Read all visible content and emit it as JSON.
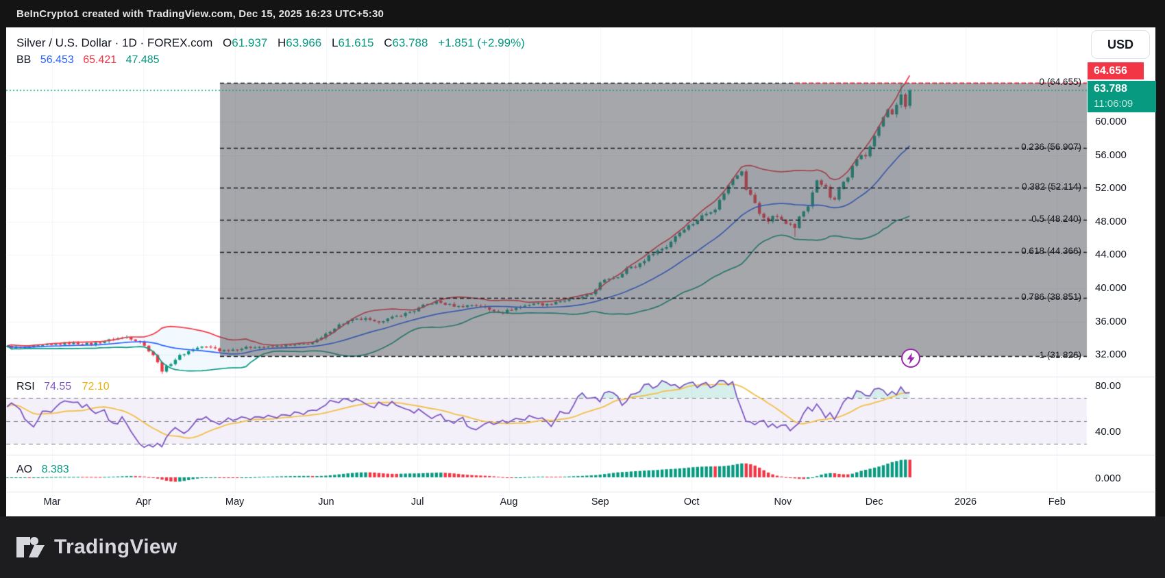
{
  "top_bar": {
    "text": "BeInCrypto1 created with TradingView.com, Dec 15, 2025 16:23 UTC+5:30"
  },
  "legend": {
    "symbol": "Silver / U.S. Dollar",
    "separator": "·",
    "interval": "1D",
    "exchange": "FOREX.com",
    "o_label": "O",
    "o_value": "61.937",
    "h_label": "H",
    "h_value": "63.966",
    "l_label": "L",
    "l_value": "61.615",
    "c_label": "C",
    "c_value": "63.788",
    "change": "+1.851 (+2.99%)",
    "bb_label": "BB",
    "bb_basis": "56.453",
    "bb_upper": "65.421",
    "bb_lower": "47.485",
    "rsi_label": "RSI",
    "rsi_value": "74.55",
    "rsi_ma_value": "72.10",
    "ao_label": "AO",
    "ao_value": "8.383"
  },
  "price_axis": {
    "currency": "USD",
    "high_badge": "64.656",
    "last_badge_price": "63.788",
    "last_badge_time": "11:06:09",
    "tick_labels": [
      "60.000",
      "56.000",
      "52.000",
      "48.000",
      "44.000",
      "40.000",
      "36.000",
      "32.000"
    ],
    "tick_values": [
      60,
      56,
      52,
      48,
      44,
      40,
      36,
      32
    ]
  },
  "rsi_axis": {
    "tick_labels": [
      "80.00",
      "40.00"
    ],
    "tick_values": [
      80,
      40
    ]
  },
  "ao_axis": {
    "tick_labels": [
      "0.000"
    ],
    "tick_values": [
      0
    ]
  },
  "time_axis": {
    "labels": [
      "Mar",
      "Apr",
      "May",
      "Jun",
      "Jul",
      "Aug",
      "Sep",
      "Oct",
      "Nov",
      "Dec",
      "2026",
      "Feb"
    ]
  },
  "footer": {
    "brand": "TradingView"
  },
  "chart_data": {
    "type": "candlestick",
    "title": "Silver / U.S. Dollar · 1D · FOREX.com",
    "bars_total": 205,
    "last_candle": {
      "o": 61.937,
      "h": 63.966,
      "l": 61.615,
      "c": 63.788,
      "change": "+1.851 (+2.99%)"
    },
    "price_axis_range_hint": [
      29.5,
      66.5
    ],
    "fib_levels": [
      {
        "label": "0 (64.655)",
        "price": 64.655
      },
      {
        "label": "0.236 (56.907)",
        "price": 56.907
      },
      {
        "label": "0.382 (52.114)",
        "price": 52.114
      },
      {
        "label": "0.5 (48.240)",
        "price": 48.24
      },
      {
        "label": "0.618 (44.366)",
        "price": 44.366
      },
      {
        "label": "0.786 (38.851)",
        "price": 38.851
      },
      {
        "label": "1 (31.826)",
        "price": 31.826
      }
    ],
    "current_price_line": 63.788,
    "indicators": {
      "bollinger": {
        "period": 20,
        "stddev": 2,
        "basis_last": 56.453,
        "upper_last": 65.421,
        "lower_last": 47.485
      },
      "rsi": {
        "period": 14,
        "smoothing": 14,
        "last": 74.55,
        "ma_last": 72.1,
        "bands": [
          70,
          50,
          30
        ]
      },
      "ao": {
        "fast": 5,
        "slow": 34,
        "last": 8.383
      }
    },
    "price_waypoints": [
      [
        0,
        33.0
      ],
      [
        3,
        32.8
      ],
      [
        8,
        33.1
      ],
      [
        14,
        33.4
      ],
      [
        19,
        33.3
      ],
      [
        24,
        33.9
      ],
      [
        27,
        34.15
      ],
      [
        30,
        33.6
      ],
      [
        33,
        32.0
      ],
      [
        35,
        30.1
      ],
      [
        37,
        31.0
      ],
      [
        39,
        31.9
      ],
      [
        42,
        32.7
      ],
      [
        44,
        33.0
      ],
      [
        47,
        32.8
      ],
      [
        48,
        32.5
      ],
      [
        52,
        32.7
      ],
      [
        56,
        33.0
      ],
      [
        59,
        32.9
      ],
      [
        62,
        33.1
      ],
      [
        66,
        33.2
      ],
      [
        69,
        33.5
      ],
      [
        71,
        34.0
      ],
      [
        73,
        34.9
      ],
      [
        75,
        35.6
      ],
      [
        78,
        36.2
      ],
      [
        81,
        36.3
      ],
      [
        83,
        35.9
      ],
      [
        86,
        36.3
      ],
      [
        89,
        36.8
      ],
      [
        92,
        37.3
      ],
      [
        94,
        37.9
      ],
      [
        97,
        38.4
      ],
      [
        99,
        38.1
      ],
      [
        102,
        37.8
      ],
      [
        105,
        38.0
      ],
      [
        107,
        37.9
      ],
      [
        109,
        37.4
      ],
      [
        112,
        37.1
      ],
      [
        114,
        37.5
      ],
      [
        117,
        37.9
      ],
      [
        119,
        38.2
      ],
      [
        122,
        38.0
      ],
      [
        124,
        38.4
      ],
      [
        127,
        38.6
      ],
      [
        130,
        38.9
      ],
      [
        132,
        39.3
      ],
      [
        134,
        40.6
      ],
      [
        136,
        41.2
      ],
      [
        138,
        41.4
      ],
      [
        140,
        42.4
      ],
      [
        142,
        42.6
      ],
      [
        144,
        43.4
      ],
      [
        146,
        44.3
      ],
      [
        149,
        45.0
      ],
      [
        151,
        46.3
      ],
      [
        153,
        47.2
      ],
      [
        155,
        47.8
      ],
      [
        157,
        48.7
      ],
      [
        160,
        49.6
      ],
      [
        162,
        51.5
      ],
      [
        164,
        53.2
      ],
      [
        166,
        54.2
      ],
      [
        167,
        52.0
      ],
      [
        169,
        50.3
      ],
      [
        170,
        48.9
      ],
      [
        172,
        48.1
      ],
      [
        173,
        48.7
      ],
      [
        175,
        48.3
      ],
      [
        176,
        47.9
      ],
      [
        178,
        47.3
      ],
      [
        179,
        48.5
      ],
      [
        181,
        50.0
      ],
      [
        182,
        51.7
      ],
      [
        183,
        52.9
      ],
      [
        185,
        52.1
      ],
      [
        186,
        50.9
      ],
      [
        187,
        50.7
      ],
      [
        188,
        52.0
      ],
      [
        190,
        53.3
      ],
      [
        191,
        54.7
      ],
      [
        192,
        55.5
      ],
      [
        193,
        55.9
      ],
      [
        194,
        55.7
      ],
      [
        195,
        56.9
      ],
      [
        196,
        58.3
      ],
      [
        197,
        59.5
      ],
      [
        198,
        60.7
      ],
      [
        199,
        61.4
      ],
      [
        200,
        60.9
      ],
      [
        201,
        62.0
      ],
      [
        202,
        63.2
      ],
      [
        203,
        61.94
      ],
      [
        204,
        63.788
      ]
    ],
    "candle_overrides": {
      "35": {
        "l": 29.7
      },
      "178": {
        "l": 46.2
      },
      "202": {
        "h": 64.655
      },
      "204": {
        "o": 61.937,
        "h": 63.966,
        "l": 61.615,
        "c": 63.788
      }
    },
    "rsi_waypoints": [
      [
        0,
        62
      ],
      [
        1,
        65
      ],
      [
        3,
        60
      ],
      [
        4,
        51
      ],
      [
        6,
        44
      ],
      [
        8,
        59
      ],
      [
        10,
        57
      ],
      [
        12,
        66
      ],
      [
        13,
        67
      ],
      [
        16,
        66
      ],
      [
        17,
        61
      ],
      [
        18,
        64
      ],
      [
        20,
        56
      ],
      [
        22,
        60
      ],
      [
        23,
        50
      ],
      [
        25,
        47
      ],
      [
        26,
        54
      ],
      [
        28,
        41
      ],
      [
        30,
        30
      ],
      [
        31,
        26.5
      ],
      [
        32,
        29
      ],
      [
        33,
        27.5
      ],
      [
        34,
        31
      ],
      [
        35,
        28
      ],
      [
        36,
        35
      ],
      [
        37,
        41
      ],
      [
        38,
        44
      ],
      [
        40,
        39
      ],
      [
        41,
        42
      ],
      [
        43,
        51
      ],
      [
        45,
        53
      ],
      [
        47,
        49
      ],
      [
        48,
        47
      ],
      [
        50,
        52
      ],
      [
        51,
        50
      ],
      [
        53,
        53
      ],
      [
        55,
        51
      ],
      [
        56,
        54
      ],
      [
        58,
        52
      ],
      [
        59,
        55
      ],
      [
        61,
        53
      ],
      [
        62,
        56
      ],
      [
        64,
        54
      ],
      [
        65,
        58
      ],
      [
        67,
        56
      ],
      [
        69,
        60
      ],
      [
        70,
        59
      ],
      [
        72,
        64
      ],
      [
        73,
        68
      ],
      [
        75,
        66
      ],
      [
        76,
        70
      ],
      [
        78,
        67
      ],
      [
        79,
        69
      ],
      [
        81,
        65
      ],
      [
        83,
        62
      ],
      [
        84,
        66
      ],
      [
        86,
        63
      ],
      [
        87,
        67
      ],
      [
        88,
        64
      ],
      [
        90,
        61
      ],
      [
        92,
        57
      ],
      [
        93,
        60
      ],
      [
        95,
        55
      ],
      [
        96,
        52
      ],
      [
        98,
        56
      ],
      [
        99,
        51
      ],
      [
        101,
        48
      ],
      [
        103,
        53
      ],
      [
        104,
        46
      ],
      [
        106,
        42
      ],
      [
        107,
        45
      ],
      [
        109,
        49
      ],
      [
        110,
        47
      ],
      [
        112,
        50
      ],
      [
        113,
        48
      ],
      [
        115,
        52
      ],
      [
        117,
        50
      ],
      [
        118,
        54
      ],
      [
        120,
        52
      ],
      [
        121,
        53
      ],
      [
        123,
        45
      ],
      [
        125,
        58
      ],
      [
        127,
        56
      ],
      [
        129,
        71
      ],
      [
        130,
        74
      ],
      [
        131,
        69
      ],
      [
        133,
        70
      ],
      [
        134,
        67
      ],
      [
        135,
        75
      ],
      [
        136,
        76
      ],
      [
        138,
        72
      ],
      [
        139,
        64
      ],
      [
        140,
        67
      ],
      [
        141,
        73
      ],
      [
        143,
        75
      ],
      [
        144,
        81
      ],
      [
        145,
        82
      ],
      [
        146,
        79
      ],
      [
        147,
        81
      ],
      [
        148,
        85
      ],
      [
        150,
        81
      ],
      [
        151,
        82
      ],
      [
        152,
        79
      ],
      [
        153,
        81
      ],
      [
        155,
        84
      ],
      [
        156,
        79
      ],
      [
        157,
        82
      ],
      [
        158,
        84
      ],
      [
        159,
        79
      ],
      [
        160,
        81
      ],
      [
        161,
        85
      ],
      [
        162,
        85
      ],
      [
        163,
        81
      ],
      [
        164,
        84
      ],
      [
        165,
        70
      ],
      [
        166,
        60
      ],
      [
        167,
        50
      ],
      [
        169,
        47
      ],
      [
        171,
        51
      ],
      [
        172,
        44
      ],
      [
        173,
        47
      ],
      [
        174,
        44
      ],
      [
        176,
        47
      ],
      [
        177,
        42
      ],
      [
        179,
        48
      ],
      [
        180,
        57
      ],
      [
        181,
        62
      ],
      [
        182,
        59
      ],
      [
        183,
        65
      ],
      [
        184,
        60
      ],
      [
        185,
        53
      ],
      [
        186,
        57
      ],
      [
        187,
        51
      ],
      [
        188,
        58
      ],
      [
        189,
        66
      ],
      [
        190,
        71
      ],
      [
        191,
        69
      ],
      [
        192,
        76
      ],
      [
        193,
        75
      ],
      [
        194,
        72
      ],
      [
        195,
        71
      ],
      [
        196,
        77
      ],
      [
        197,
        79
      ],
      [
        198,
        76
      ],
      [
        199,
        72
      ],
      [
        200,
        75
      ],
      [
        201,
        73
      ],
      [
        202,
        79
      ],
      [
        203,
        74
      ],
      [
        204,
        74.55
      ]
    ],
    "colors": {
      "up": "#089981",
      "down": "#f23645",
      "bb_basis": "#2962ff",
      "bb_upper": "#f23645",
      "bb_lower": "#089981",
      "bb_fill": "rgba(33,150,243,0.06)",
      "fib_box_fill": "rgba(77,79,85,0.5)",
      "fib_line": "#16191f",
      "fib_zero_red": "#f23645",
      "current_price_dotted": "#089981",
      "rsi_line": "#7e57c2",
      "rsi_ma_line": "#f2c14e",
      "rsi_band_fill": "rgba(126,87,194,0.09)",
      "rsi_overbought_fill": "rgba(8,153,129,0.16)",
      "dashed_band": "#787b86",
      "grid": "#f0f3fa",
      "separator": "#e0e3eb"
    }
  }
}
